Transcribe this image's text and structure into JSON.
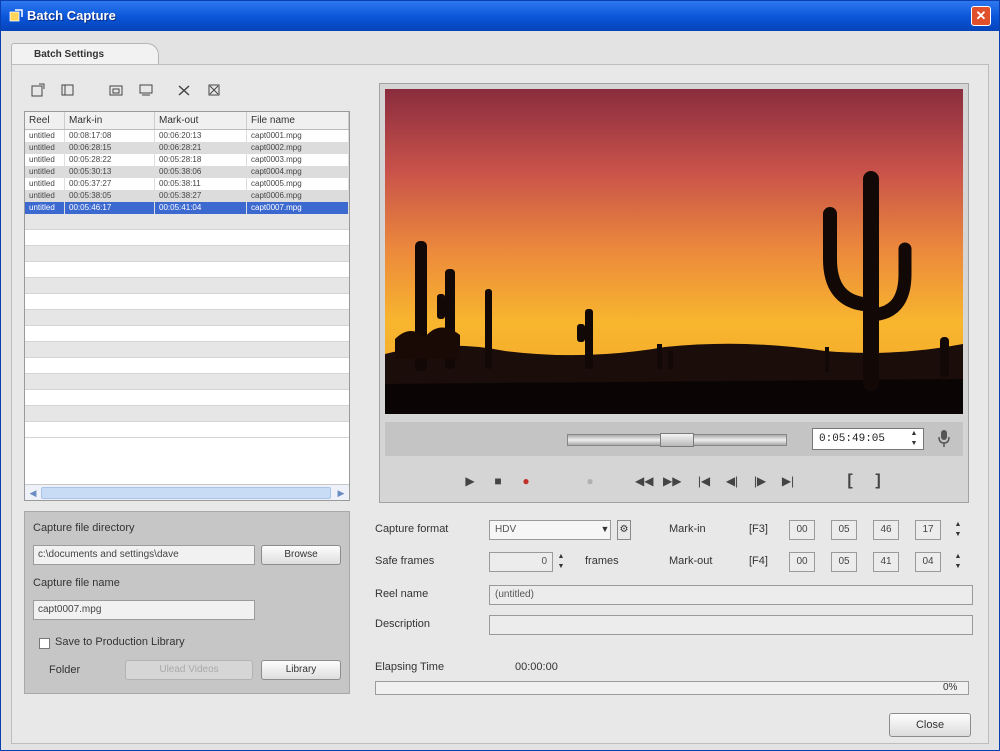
{
  "window": {
    "title": "Batch Capture",
    "close_glyph": "✕"
  },
  "tab": {
    "label": "Batch Settings"
  },
  "toolbar": {
    "icons": [
      "new-icon",
      "open-icon",
      "folder-icon",
      "save-icon",
      "delete-icon",
      "clear-icon"
    ]
  },
  "table": {
    "columns": [
      "Reel",
      "Mark-in",
      "Mark-out",
      "File name"
    ],
    "rows": [
      [
        "untitled",
        "00:08:17:08",
        "00:06:20:13",
        "capt0001.mpg"
      ],
      [
        "untitled",
        "00:06:28:15",
        "00:06:28:21",
        "capt0002.mpg"
      ],
      [
        "untitled",
        "00:05:28:22",
        "00:05:28:18",
        "capt0003.mpg"
      ],
      [
        "untitled",
        "00:05:30:13",
        "00:05:38:06",
        "capt0004.mpg"
      ],
      [
        "untitled",
        "00:05:37:27",
        "00:05:38:11",
        "capt0005.mpg"
      ],
      [
        "untitled",
        "00:05:38:05",
        "00:05:38:27",
        "capt0006.mpg"
      ],
      [
        "untitled",
        "00:05:46:17",
        "00:05:41:04",
        "capt0007.mpg"
      ]
    ],
    "selected_index": 6
  },
  "capture": {
    "directory_label": "Capture file directory",
    "directory_value": "c:\\documents and settings\\dave",
    "browse_label": "Browse",
    "file_name_label": "Capture file name",
    "file_name_value": "capt0007.mpg",
    "save_to_library_label": "Save to Production Library",
    "folder_label": "Folder",
    "folder_value": "Ulead Videos",
    "library_label": "Library"
  },
  "preview": {
    "timecode": "0:05:49:05",
    "controls": [
      "play-icon",
      "stop-icon",
      "record-icon",
      "capture-icon",
      "rewind-icon",
      "fast-forward-icon",
      "go-start-icon",
      "step-back-icon",
      "step-forward-icon",
      "go-end-icon",
      "mark-in-icon",
      "mark-out-icon"
    ]
  },
  "settings": {
    "format_label": "Capture format",
    "format_value": "HDV",
    "split_label": "Safe frames",
    "split_value": "0",
    "split_unit": "frames",
    "reel_label": "Reel name",
    "reel_value": "(untitled)",
    "desc_label": "Description",
    "desc_value": "",
    "mark_in_label": "Mark-in",
    "mark_in_key": "[F3]",
    "mark_in": [
      "00",
      "05",
      "46",
      "17"
    ],
    "mark_out_label": "Mark-out",
    "mark_out_key": "[F4]",
    "mark_out": [
      "00",
      "05",
      "41",
      "04"
    ]
  },
  "status": {
    "elapsed_label": "Elapsing Time",
    "elapsed_value": "00:00:00",
    "progress_percent": 0,
    "progress_text": "0%"
  },
  "footer": {
    "close_label": "Close"
  }
}
